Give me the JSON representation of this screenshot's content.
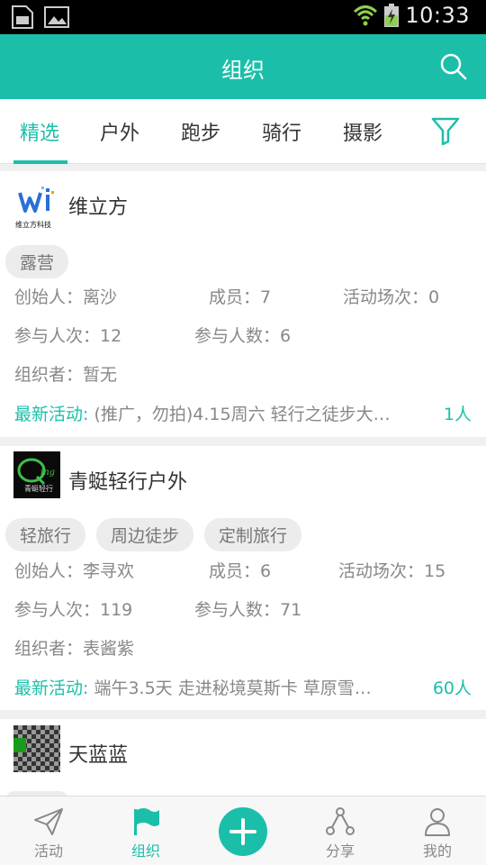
{
  "status_bar": {
    "time": "10:33"
  },
  "header": {
    "title": "组织"
  },
  "tabs": [
    {
      "label": "精选"
    },
    {
      "label": "户外"
    },
    {
      "label": "跑步"
    },
    {
      "label": "骑行"
    },
    {
      "label": "摄影"
    }
  ],
  "orgs": [
    {
      "name": "维立方",
      "logo_text": "维立方科技",
      "tags": [
        "露营"
      ],
      "founder": "创始人：离沙",
      "members": "成员：7",
      "events": "活动场次：0",
      "participations": "参与人次：12",
      "participants": "参与人数：6",
      "organizer": "组织者：暂无",
      "latest_label": "最新活动:",
      "latest_text": " (推广，勿拍)4.15周六 轻行之徒步大…",
      "latest_count": "1人"
    },
    {
      "name": "青蜓轻行户外",
      "logo_text": "青蜓轻行",
      "tags": [
        "轻旅行",
        "周边徒步",
        "定制旅行"
      ],
      "founder": "创始人：李寻欢",
      "members": "成员：6",
      "events": "活动场次：15",
      "participations": "参与人次：119",
      "participants": "参与人数：71",
      "organizer": "组织者：表酱紫",
      "latest_label": "最新活动:",
      "latest_text": " 端午3.5天 走进秘境莫斯卡 草原雪…",
      "latest_count": "60人"
    },
    {
      "name": "天蓝蓝"
    }
  ],
  "bottom_nav": [
    {
      "label": "活动"
    },
    {
      "label": "组织"
    },
    {
      "label": "分享"
    },
    {
      "label": "我的"
    }
  ],
  "colors": {
    "accent": "#1bbfa9",
    "tag_bg": "#ececec",
    "text_secondary": "#888888"
  }
}
